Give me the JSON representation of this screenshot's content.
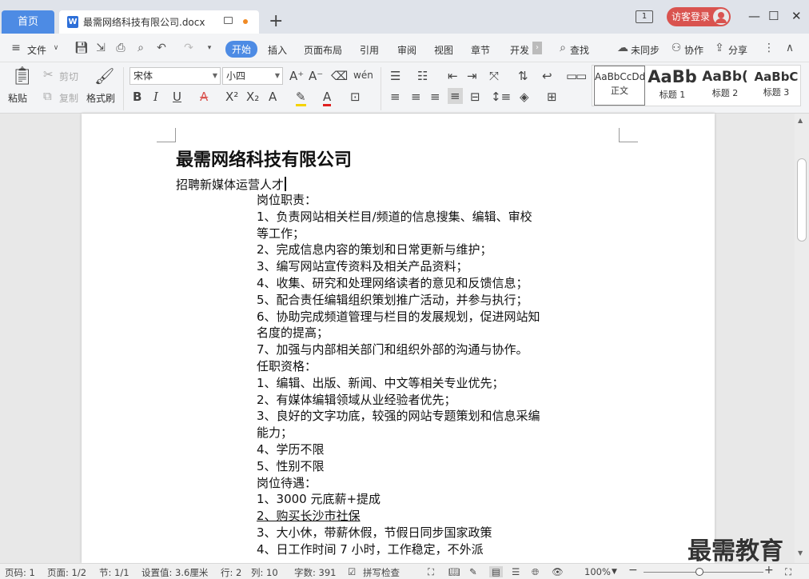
{
  "titlebar": {
    "home_tab": "首页",
    "doc_tab": "最需网络科技有限公司.docx",
    "new_tab": "+",
    "window_num": "1",
    "visitor_login": "访客登录"
  },
  "menubar": {
    "file": "文件",
    "items": [
      "开始",
      "插入",
      "页面布局",
      "引用",
      "审阅",
      "视图",
      "章节",
      "开发"
    ],
    "search": "查找",
    "sync": "未同步",
    "collab": "协作",
    "share": "分享"
  },
  "ribbon": {
    "paste": "粘贴",
    "cut": "剪切",
    "copy": "复制",
    "format_painter": "格式刷",
    "font_name": "宋体",
    "font_size": "小四",
    "styles": [
      {
        "preview": "AaBbCcDd",
        "label": "正文"
      },
      {
        "preview": "AaBb",
        "label": "标题 1"
      },
      {
        "preview": "AaBb(",
        "label": "标题 2"
      },
      {
        "preview": "AaBbC",
        "label": "标题 3"
      }
    ]
  },
  "document": {
    "title": "最需网络科技有限公司",
    "subtitle": "招聘新媒体运营人才",
    "lines": [
      "岗位职责：",
      "1、负责网站相关栏目/频道的信息搜集、编辑、审校",
      "等工作；",
      "2、完成信息内容的策划和日常更新与维护；",
      "3、编写网站宣传资料及相关产品资料；",
      "4、收集、研究和处理网络读者的意见和反馈信息；",
      "5、配合责任编辑组织策划推广活动，并参与执行；",
      "6、协助完成频道管理与栏目的发展规划，促进网站知",
      "名度的提高；",
      "7、加强与内部相关部门和组织外部的沟通与协作。",
      "任职资格：",
      "1、编辑、出版、新闻、中文等相关专业优先；",
      "2、有媒体编辑领域从业经验者优先；",
      "3、良好的文字功底，较强的网站专题策划和信息采编",
      "能力；",
      "4、学历不限",
      "5、性别不限",
      "岗位待遇：",
      "1、3000 元底薪+提成",
      "2、购买长沙市社保",
      "3、大小休，带薪休假，节假日同步国家政策",
      "4、日工作时间 7 小时，工作稳定，不外派"
    ]
  },
  "watermark": "最需教育",
  "status": {
    "page_num": "页码: 1",
    "pages": "页面: 1/2",
    "section": "节: 1/1",
    "setting": "设置值: 3.6厘米",
    "row": "行: 2",
    "col": "列: 10",
    "words": "字数: 391",
    "spell": "拼写检查",
    "zoom": "100%"
  },
  "colors": {
    "accent": "#4d8be4",
    "visitor": "#d9534f",
    "modified_dot": "#f08a24"
  }
}
